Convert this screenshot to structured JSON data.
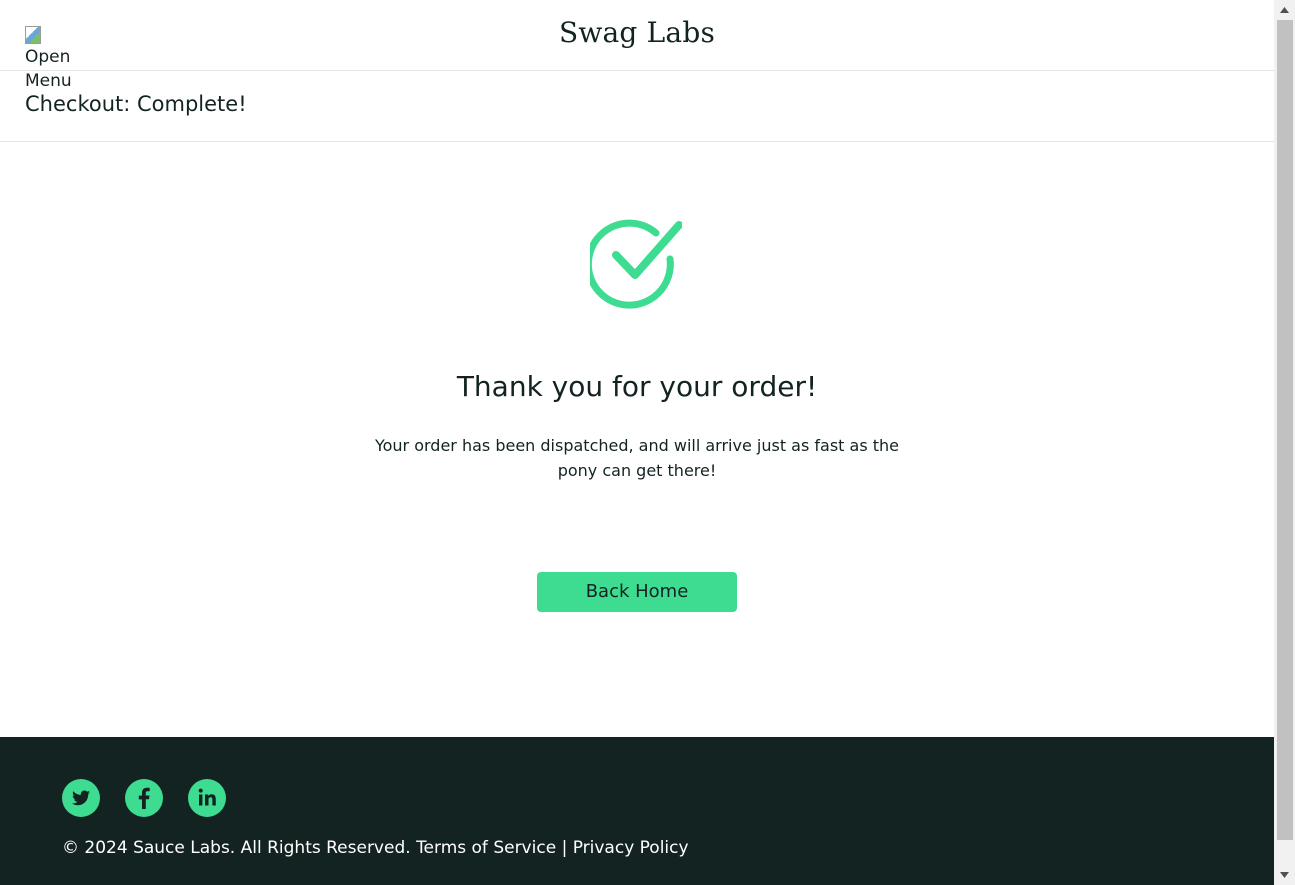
{
  "header": {
    "menu_button_label": "Open Menu",
    "app_logo": "Swag Labs",
    "page_title": "Checkout: Complete!"
  },
  "complete": {
    "icon": "checkmark-circle-icon",
    "header": "Thank you for your order!",
    "text": "Your order has been dispatched, and will arrive just as fast as the pony can get there!",
    "back_home_label": "Back Home"
  },
  "footer": {
    "social": [
      {
        "name": "twitter",
        "icon": "twitter-icon"
      },
      {
        "name": "facebook",
        "icon": "facebook-icon"
      },
      {
        "name": "linkedin",
        "icon": "linkedin-icon"
      }
    ],
    "copyright": "© 2024 Sauce Labs. All Rights Reserved.",
    "terms_label": "Terms of Service",
    "separator": "|",
    "privacy_label": "Privacy Policy"
  },
  "colors": {
    "accent": "#3ddc91",
    "text": "#132322",
    "footer_bg": "#132322"
  }
}
